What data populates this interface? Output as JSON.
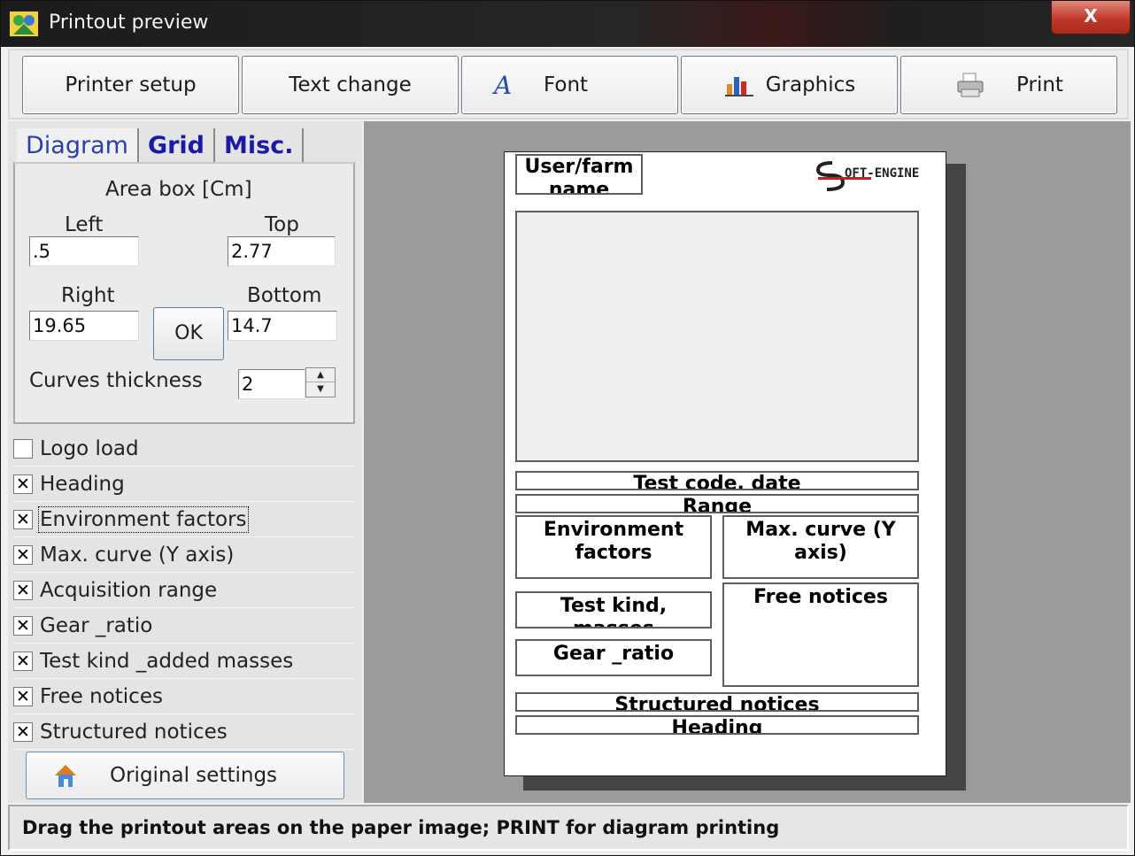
{
  "window": {
    "title": "Printout preview",
    "close_label": "X"
  },
  "toolbar": {
    "printer_setup": "Printer setup",
    "text_change": "Text change",
    "font": "Font",
    "graphics": "Graphics",
    "print": "Print"
  },
  "tabs": {
    "diagram": "Diagram",
    "grid": "Grid",
    "misc": "Misc."
  },
  "area_box": {
    "title": "Area box [Cm]",
    "left_label": "Left",
    "left_value": ".5",
    "top_label": "Top",
    "top_value": "2.77",
    "right_label": "Right",
    "right_value": "19.65",
    "bottom_label": "Bottom",
    "bottom_value": "14.7",
    "ok_label": "OK",
    "curves_label": "Curves thickness",
    "curves_value": "2"
  },
  "checkboxes": [
    {
      "label": "Logo load",
      "checked": false
    },
    {
      "label": "Heading",
      "checked": true
    },
    {
      "label": "Environment factors",
      "checked": true
    },
    {
      "label": "Max. curve (Y axis)",
      "checked": true
    },
    {
      "label": "Acquisition range",
      "checked": true
    },
    {
      "label": "Gear _ratio",
      "checked": true
    },
    {
      "label": "Test kind _added masses",
      "checked": true
    },
    {
      "label": "Free notices",
      "checked": true
    },
    {
      "label": "Structured notices",
      "checked": true
    }
  ],
  "original_settings": "Original settings",
  "paper": {
    "user_farm": "User/farm name",
    "logo_text": "OFT-ENGINE",
    "test_code": "Test code, date",
    "range": "Range",
    "environment": "Environment factors",
    "max_curve": "Max. curve (Y axis)",
    "free_notices": "Free notices",
    "test_kind": "Test kind, masses",
    "gear_ratio": "Gear _ratio",
    "structured": "Structured notices",
    "heading": "Heading"
  },
  "status": "Drag the printout areas on the paper image; PRINT for diagram printing"
}
